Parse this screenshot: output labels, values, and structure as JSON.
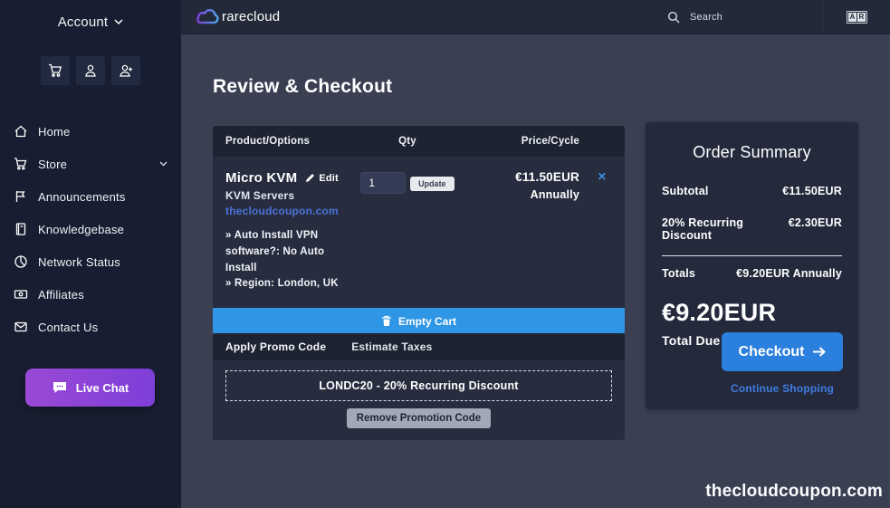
{
  "sidebar": {
    "account_label": "Account",
    "live_chat_label": "Live Chat",
    "items": [
      {
        "label": "Home"
      },
      {
        "label": "Store"
      },
      {
        "label": "Announcements"
      },
      {
        "label": "Knowledgebase"
      },
      {
        "label": "Network Status"
      },
      {
        "label": "Affiliates"
      },
      {
        "label": "Contact Us"
      }
    ]
  },
  "topbar": {
    "brand": "rarecloud",
    "search_placeholder": "Search",
    "lang_left": "A",
    "lang_right": "R"
  },
  "page": {
    "title": "Review & Checkout",
    "watermark": "thecloudcoupon.com"
  },
  "cart_table": {
    "headers": {
      "product": "Product/Options",
      "qty": "Qty",
      "price": "Price/Cycle"
    },
    "item": {
      "name": "Micro KVM",
      "edit_label": "Edit",
      "group": "KVM Servers",
      "domain": "thecloudcoupon.com",
      "options": [
        "» Auto Install VPN software?: No Auto Install",
        "» Region: London, UK"
      ],
      "qty_value": "1",
      "update_label": "Update",
      "price": "€11.50EUR",
      "cycle": "Annually",
      "remove_glyph": "✕"
    },
    "empty_cart_label": "Empty Cart"
  },
  "promo": {
    "tab_apply": "Apply Promo Code",
    "tab_taxes": "Estimate Taxes",
    "applied_code": "LONDC20 - 20% Recurring Discount",
    "remove_label": "Remove Promotion Code"
  },
  "summary": {
    "title": "Order Summary",
    "subtotal_label": "Subtotal",
    "subtotal_value": "€11.50EUR",
    "discount_label": "20% Recurring Discount",
    "discount_value": "€2.30EUR",
    "totals_label": "Totals",
    "totals_value": "€9.20EUR Annually",
    "due_amount": "€9.20EUR",
    "due_label": "Total Due Today",
    "checkout_label": "Checkout",
    "continue_label": "Continue Shopping"
  },
  "colors": {
    "accent_blue": "#2e96e4",
    "checkout_blue": "#2b7fdd",
    "link_blue": "#4a72d8",
    "chat_purple": "#8a43d4",
    "sidebar_bg": "#181e31",
    "card_bg": "#272d3f",
    "card_header_bg": "#1d2331",
    "main_bg": "#3a3f52"
  }
}
